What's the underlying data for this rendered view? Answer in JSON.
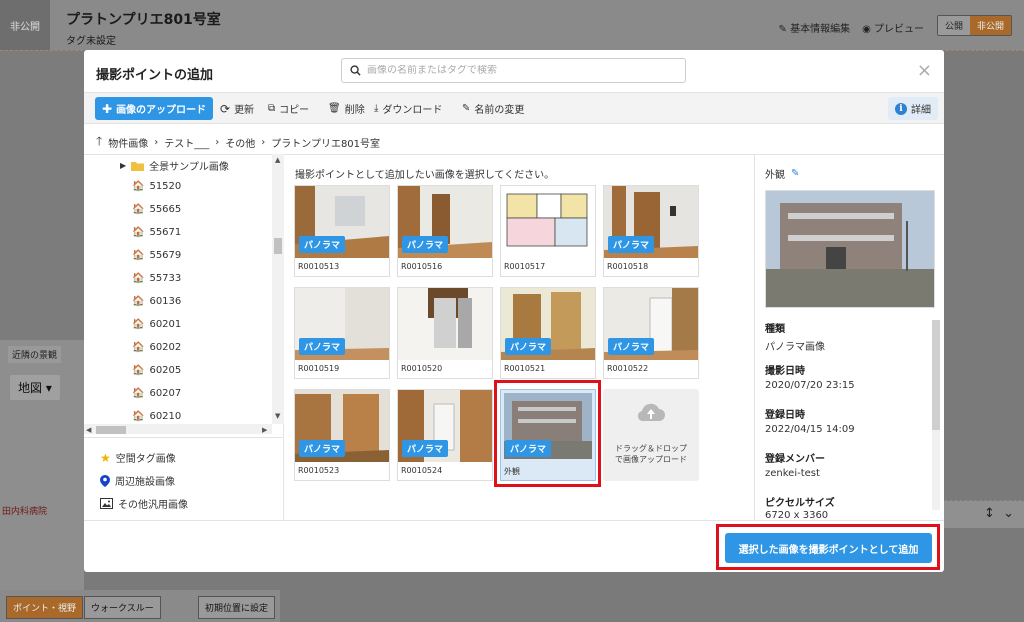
{
  "app": {
    "status": "非公開",
    "title": "プラトンプリエ801号室",
    "subtitle": "タグ未設定",
    "edit_basic": "基本情報編集",
    "preview": "プレビュー",
    "toggle_public": "公開",
    "toggle_private": "非公開",
    "nearby_label": "近隣の景観",
    "map_button": "地図",
    "map_hospital": "田内科病院",
    "btn_point": "ポイント・視野",
    "btn_walk": "ウォークスルー",
    "btn_reset": "初期位置に設定"
  },
  "modal": {
    "title": "撮影ポイントの追加",
    "search_placeholder": "画像の名前またはタグで検索",
    "close": "×"
  },
  "toolbar": {
    "upload": "画像のアップロード",
    "update": "更新",
    "copy": "コピー",
    "delete": "削除",
    "download": "ダウンロード",
    "rename": "名前の変更",
    "detail": "詳細"
  },
  "breadcrumb": {
    "items": [
      "物件画像",
      "テスト___",
      "その他",
      "プラトンプリエ801号室"
    ]
  },
  "tree": {
    "folder": "全景サンプル画像",
    "items": [
      "51520",
      "55665",
      "55671",
      "55679",
      "55733",
      "60136",
      "60201",
      "60202",
      "60205",
      "60207",
      "60210"
    ],
    "categories": [
      "空間タグ画像",
      "周辺施設画像",
      "その他汎用画像"
    ]
  },
  "grid": {
    "instruction": "撮影ポイントとして追加したい画像を選択してください。",
    "badge": "パノラマ",
    "cards": [
      {
        "name": "R0010513",
        "badge": true
      },
      {
        "name": "R0010516",
        "badge": true
      },
      {
        "name": "R0010517",
        "badge": false
      },
      {
        "name": "R0010518",
        "badge": true
      },
      {
        "name": "R0010519",
        "badge": true
      },
      {
        "name": "R0010520",
        "badge": false
      },
      {
        "name": "R0010521",
        "badge": true
      },
      {
        "name": "R0010522",
        "badge": true
      },
      {
        "name": "R0010523",
        "badge": true
      },
      {
        "name": "R0010524",
        "badge": true
      },
      {
        "name": "外観",
        "badge": true,
        "selected": true
      }
    ],
    "drop_text_line1": "ドラッグ＆ドロップ",
    "drop_text_line2": "で画像アップロード"
  },
  "details": {
    "name": "外観",
    "kind_label": "種類",
    "kind_value": "パノラマ画像",
    "shot_label": "撮影日時",
    "shot_value": "2020/07/20 23:15",
    "reg_label": "登録日時",
    "reg_value": "2022/04/15 14:09",
    "member_label": "登録メンバー",
    "member_value": "zenkei-test",
    "pixel_label": "ピクセルサイズ",
    "pixel_value": "6720 x 3360"
  },
  "footer": {
    "add_button": "選択した画像を撮影ポイントとして追加"
  },
  "colors": {
    "accent": "#2f96e6",
    "highlight": "#e0101a"
  }
}
